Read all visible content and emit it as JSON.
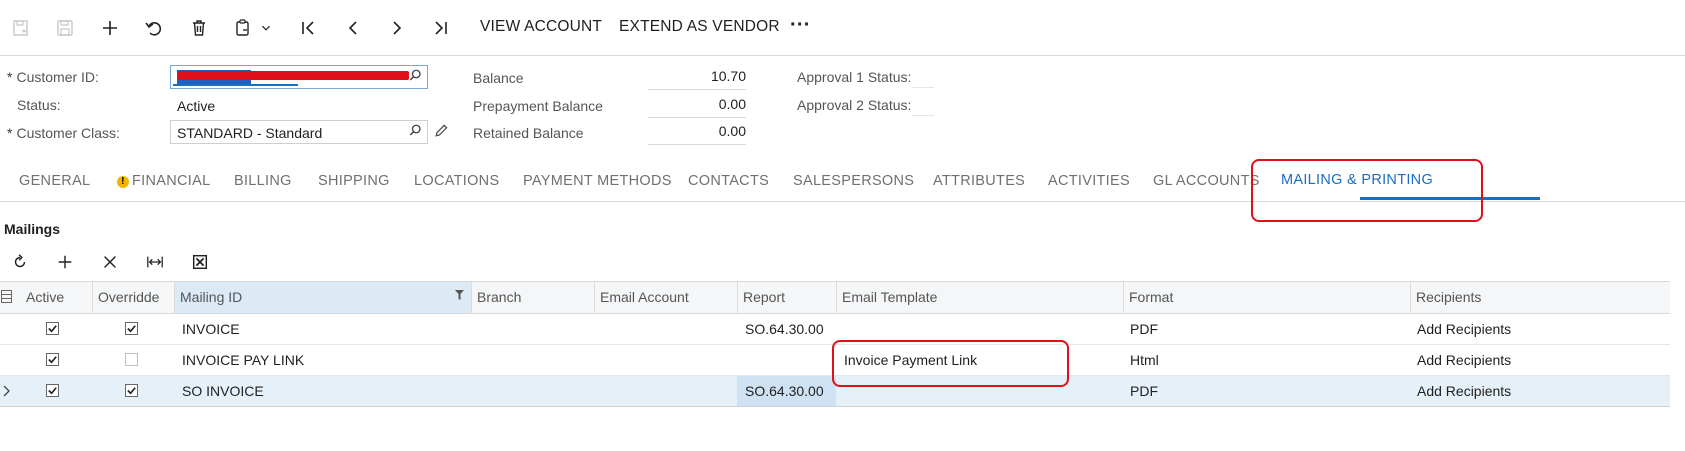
{
  "toolbar": {
    "view_account": "VIEW ACCOUNT",
    "extend_as_vendor": "EXTEND AS VENDOR",
    "more": "···"
  },
  "form": {
    "customer_id_label": "Customer ID:",
    "status_label": "Status:",
    "status_value": "Active",
    "customer_class_label": "Customer Class:",
    "customer_class_value": "STANDARD - Standard",
    "balance_label": "Balance",
    "balance_value": "10.70",
    "prepayment_label": "Prepayment Balance",
    "prepayment_value": "0.00",
    "retained_label": "Retained Balance",
    "retained_value": "0.00",
    "approval1_label": "Approval 1 Status:",
    "approval2_label": "Approval 2 Status:"
  },
  "tabs": [
    "GENERAL",
    "FINANCIAL",
    "BILLING",
    "SHIPPING",
    "LOCATIONS",
    "PAYMENT METHODS",
    "CONTACTS",
    "SALESPERSONS",
    "ATTRIBUTES",
    "ACTIVITIES",
    "GL ACCOUNTS",
    "MAILING & PRINTING"
  ],
  "active_tab": "MAILING & PRINTING",
  "mailings": {
    "title": "Mailings",
    "columns": [
      "Active",
      "Overridde",
      "Mailing ID",
      "Branch",
      "Email Account",
      "Report",
      "Email Template",
      "Format",
      "Recipients"
    ],
    "rows": [
      {
        "active": true,
        "override": true,
        "mailing_id": "INVOICE",
        "branch": "",
        "email_account": "",
        "report": "SO.64.30.00",
        "email_template": "",
        "format": "PDF",
        "recipients": "Add Recipients"
      },
      {
        "active": true,
        "override": false,
        "mailing_id": "INVOICE PAY LINK",
        "branch": "",
        "email_account": "",
        "report": "",
        "email_template": "Invoice Payment Link",
        "format": "Html",
        "recipients": "Add Recipients"
      },
      {
        "active": true,
        "override": true,
        "mailing_id": "SO INVOICE",
        "branch": "",
        "email_account": "",
        "report": "SO.64.30.00",
        "email_template": "",
        "format": "PDF",
        "recipients": "Add Recipients"
      }
    ]
  },
  "colors": {
    "accent": "#1a6ec0",
    "annotation": "#e0101a",
    "redaction": "#e0101a"
  }
}
